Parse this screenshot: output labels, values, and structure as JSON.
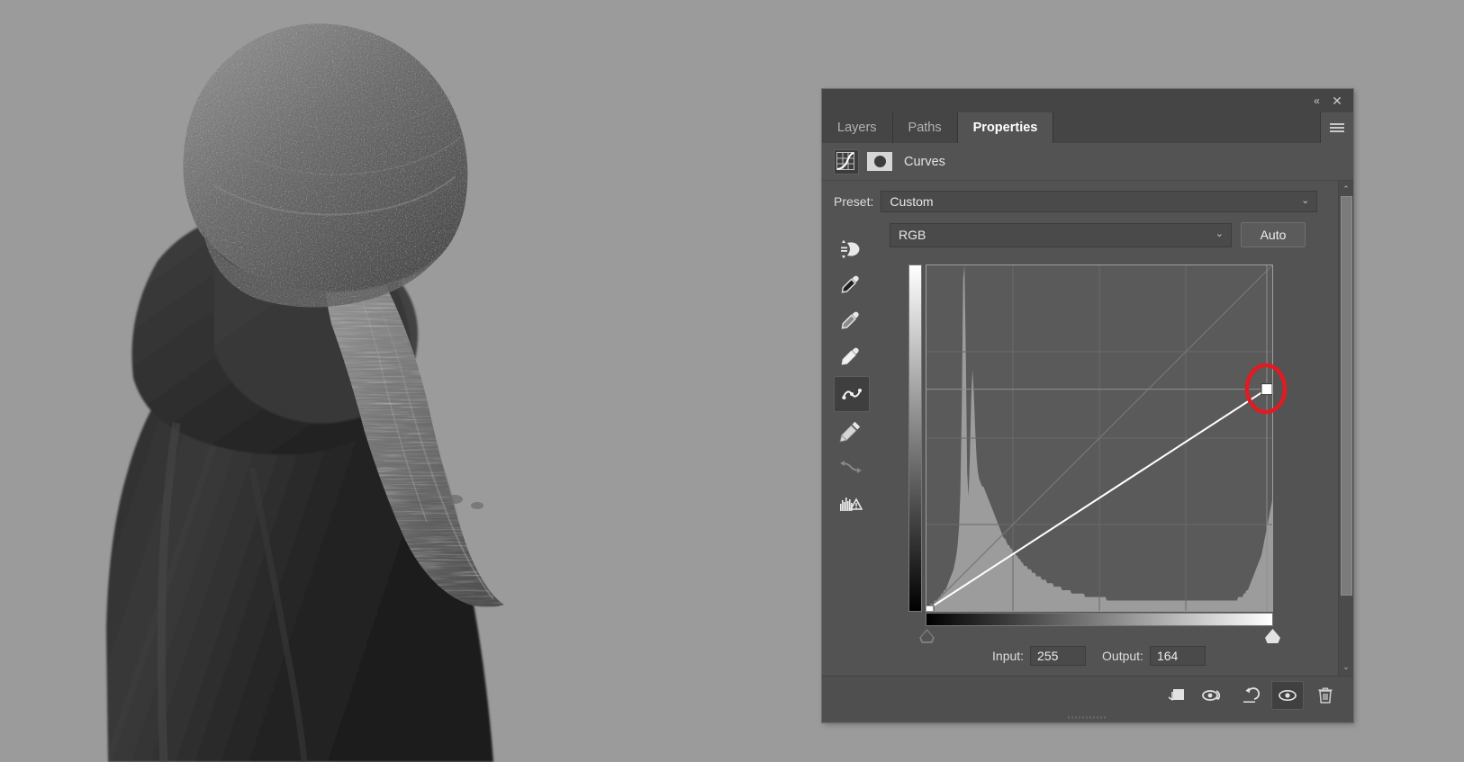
{
  "app": {
    "background_color": "#9a9a9a",
    "panel_bg": "#535353"
  },
  "photo": {
    "name": "person-in-beanie-photo",
    "description": "Grayscale photo of a person from behind wearing a knit beanie and dark jacket",
    "alt": "Black and white portrait"
  },
  "panel": {
    "titlebar": {
      "collapse_icon": "double-chevron-left-icon",
      "collapse_glyph": "«",
      "close_icon": "close-icon",
      "close_glyph": "✕"
    },
    "tabs": [
      {
        "label": "Layers",
        "active": false
      },
      {
        "label": "Paths",
        "active": false
      },
      {
        "label": "Properties",
        "active": true
      }
    ],
    "menu_icon": "hamburger-menu-icon",
    "adjustment": {
      "icon": "curves-adjustment-icon",
      "mask_icon": "layer-mask-thumbnail-icon",
      "title": "Curves"
    }
  },
  "preset": {
    "label": "Preset:",
    "value": "Custom",
    "chevron": "⌄"
  },
  "channel": {
    "value": "RGB",
    "chevron": "⌄",
    "auto_label": "Auto",
    "targeted_adjustment_icon": "on-image-adjustment-icon"
  },
  "tools": [
    {
      "name": "on-image-adjustment-tool",
      "title": "Targeted adjustment tool",
      "active": false,
      "disabled": false
    },
    {
      "name": "black-point-eyedropper",
      "title": "Sample in image to set black point",
      "active": false,
      "disabled": false
    },
    {
      "name": "gray-point-eyedropper",
      "title": "Sample in image to set gray point",
      "active": false,
      "disabled": false
    },
    {
      "name": "white-point-eyedropper",
      "title": "Sample in image to set white point",
      "active": false,
      "disabled": false
    },
    {
      "name": "curve-point-tool",
      "title": "Edit points to modify the curve",
      "active": true,
      "disabled": false
    },
    {
      "name": "pencil-draw-tool",
      "title": "Draw to modify the curve",
      "active": false,
      "disabled": false
    },
    {
      "name": "smooth-curve-tool",
      "title": "Smooth the curve values",
      "active": false,
      "disabled": true
    },
    {
      "name": "histogram-warning-icon",
      "title": "Histogram / clipping warning",
      "active": false,
      "disabled": false
    }
  ],
  "graph": {
    "name": "curves-graph",
    "grid_divisions": 4,
    "baseline_diagonal": true,
    "highlight_annotation": {
      "name": "red-circle-annotation",
      "color": "#e01b22",
      "target": "white-point-control-point"
    },
    "control_points": [
      {
        "name": "black-point",
        "input": 0,
        "output": 0,
        "selected": false
      },
      {
        "name": "white-point",
        "input": 255,
        "output": 164,
        "selected": true
      }
    ],
    "vertical_gradient": "white-to-black",
    "horizontal_gradient": "black-to-white",
    "black_point_handle": "black-point-slider-handle",
    "white_point_handle": "white-point-slider-handle"
  },
  "chart_data": {
    "type": "line",
    "title": "Curves (RGB)",
    "xlabel": "Input",
    "ylabel": "Output",
    "xlim": [
      0,
      255
    ],
    "ylim": [
      0,
      255
    ],
    "grid": true,
    "grid_divisions": 4,
    "series": [
      {
        "name": "RGB curve",
        "color": "#ffffff",
        "x": [
          0,
          255
        ],
        "y": [
          0,
          164
        ]
      },
      {
        "name": "identity baseline",
        "color": "#6f6f6f",
        "x": [
          0,
          255
        ],
        "y": [
          0,
          255
        ]
      }
    ],
    "annotations": [
      {
        "text": "selected point",
        "x": 255,
        "y": 164,
        "marker": "square",
        "highlight": "#e01b22"
      }
    ],
    "histogram": {
      "name": "luminance-histogram",
      "color": "#a8a8a8",
      "bins": [
        1,
        1,
        1,
        2,
        2,
        2,
        3,
        3,
        3,
        4,
        4,
        5,
        5,
        6,
        6,
        7,
        8,
        9,
        10,
        11,
        12,
        14,
        16,
        19,
        24,
        34,
        58,
        96,
        100,
        74,
        40,
        33,
        45,
        62,
        70,
        62,
        52,
        44,
        40,
        38,
        37,
        36,
        36,
        35,
        34,
        33,
        32,
        31,
        30,
        29,
        28,
        27,
        26,
        25,
        24,
        23,
        22,
        21,
        21,
        20,
        19,
        19,
        18,
        18,
        17,
        17,
        16,
        16,
        15,
        15,
        14,
        14,
        13,
        13,
        13,
        12,
        12,
        12,
        11,
        11,
        11,
        10,
        10,
        10,
        10,
        9,
        9,
        9,
        9,
        8,
        8,
        8,
        8,
        8,
        7,
        7,
        7,
        7,
        7,
        7,
        6,
        6,
        6,
        6,
        6,
        6,
        6,
        5,
        5,
        5,
        5,
        5,
        5,
        5,
        5,
        5,
        5,
        4,
        4,
        4,
        4,
        4,
        4,
        4,
        4,
        4,
        4,
        4,
        4,
        4,
        4,
        4,
        4,
        3,
        3,
        3,
        3,
        3,
        3,
        3,
        3,
        3,
        3,
        3,
        3,
        3,
        3,
        3,
        3,
        3,
        3,
        3,
        3,
        3,
        3,
        3,
        3,
        3,
        3,
        3,
        3,
        3,
        3,
        3,
        3,
        3,
        3,
        3,
        3,
        3,
        3,
        3,
        3,
        3,
        3,
        3,
        3,
        3,
        3,
        3,
        3,
        3,
        3,
        3,
        3,
        3,
        3,
        3,
        3,
        3,
        3,
        3,
        3,
        3,
        3,
        3,
        3,
        3,
        3,
        3,
        3,
        3,
        3,
        3,
        3,
        3,
        3,
        3,
        3,
        3,
        3,
        3,
        3,
        3,
        3,
        3,
        3,
        3,
        3,
        3,
        3,
        3,
        3,
        3,
        3,
        3,
        3,
        3,
        3,
        3,
        4,
        4,
        4,
        4,
        5,
        5,
        6,
        6,
        7,
        8,
        9,
        10,
        11,
        12,
        13,
        14,
        15,
        16,
        18,
        20,
        22,
        24,
        26,
        28,
        30,
        32
      ]
    }
  },
  "io": {
    "input_label": "Input:",
    "input_value": "255",
    "output_label": "Output:",
    "output_value": "164"
  },
  "footer": {
    "buttons": [
      {
        "name": "clip-to-layer-button",
        "icon": "clip-to-layer-icon",
        "title": "Clip to layer",
        "active": false
      },
      {
        "name": "preview-previous-state-button",
        "icon": "eye-rotate-icon",
        "title": "View previous state",
        "active": false
      },
      {
        "name": "reset-adjustment-button",
        "icon": "reset-arrow-icon",
        "title": "Reset to adjustment defaults",
        "active": false
      },
      {
        "name": "toggle-visibility-button",
        "icon": "eye-icon",
        "title": "Toggle layer visibility",
        "active": true
      },
      {
        "name": "delete-adjustment-button",
        "icon": "trash-icon",
        "title": "Delete this adjustment layer",
        "active": false
      }
    ]
  },
  "scrollbar": {
    "up_glyph": "⌃",
    "down_glyph": "⌄"
  }
}
